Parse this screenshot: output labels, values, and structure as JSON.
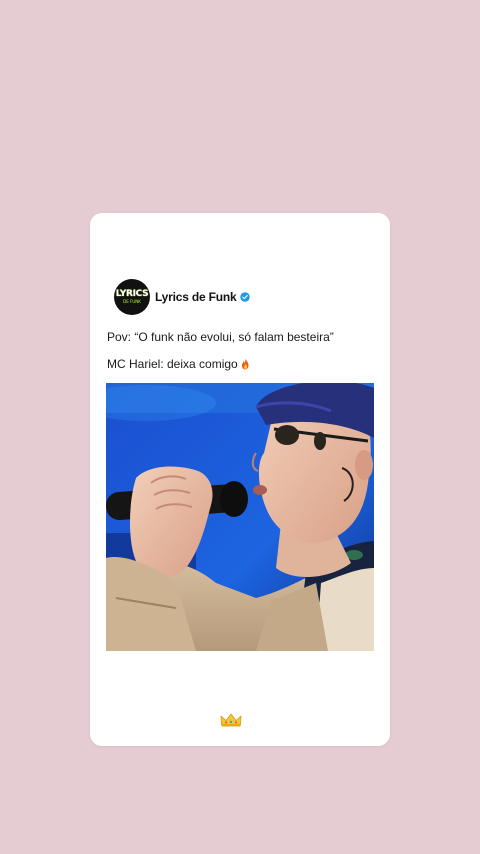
{
  "post": {
    "account_name": "Lyrics de Funk",
    "avatar_logo_top": "LYRICS",
    "avatar_logo_bottom": "DE FUNK",
    "line1": "Pov: “O funk não evolui, só falam besteira”",
    "line2": "MC Hariel: deixa comigo",
    "line2_emoji": "fire-icon",
    "verified_icon": "verified-badge-icon",
    "footer_emoji": "crown-icon"
  },
  "colors": {
    "background": "#e5cbd2",
    "card": "#ffffff",
    "verified": "#1d9bf0",
    "stage_blue": "#1d56c8"
  }
}
